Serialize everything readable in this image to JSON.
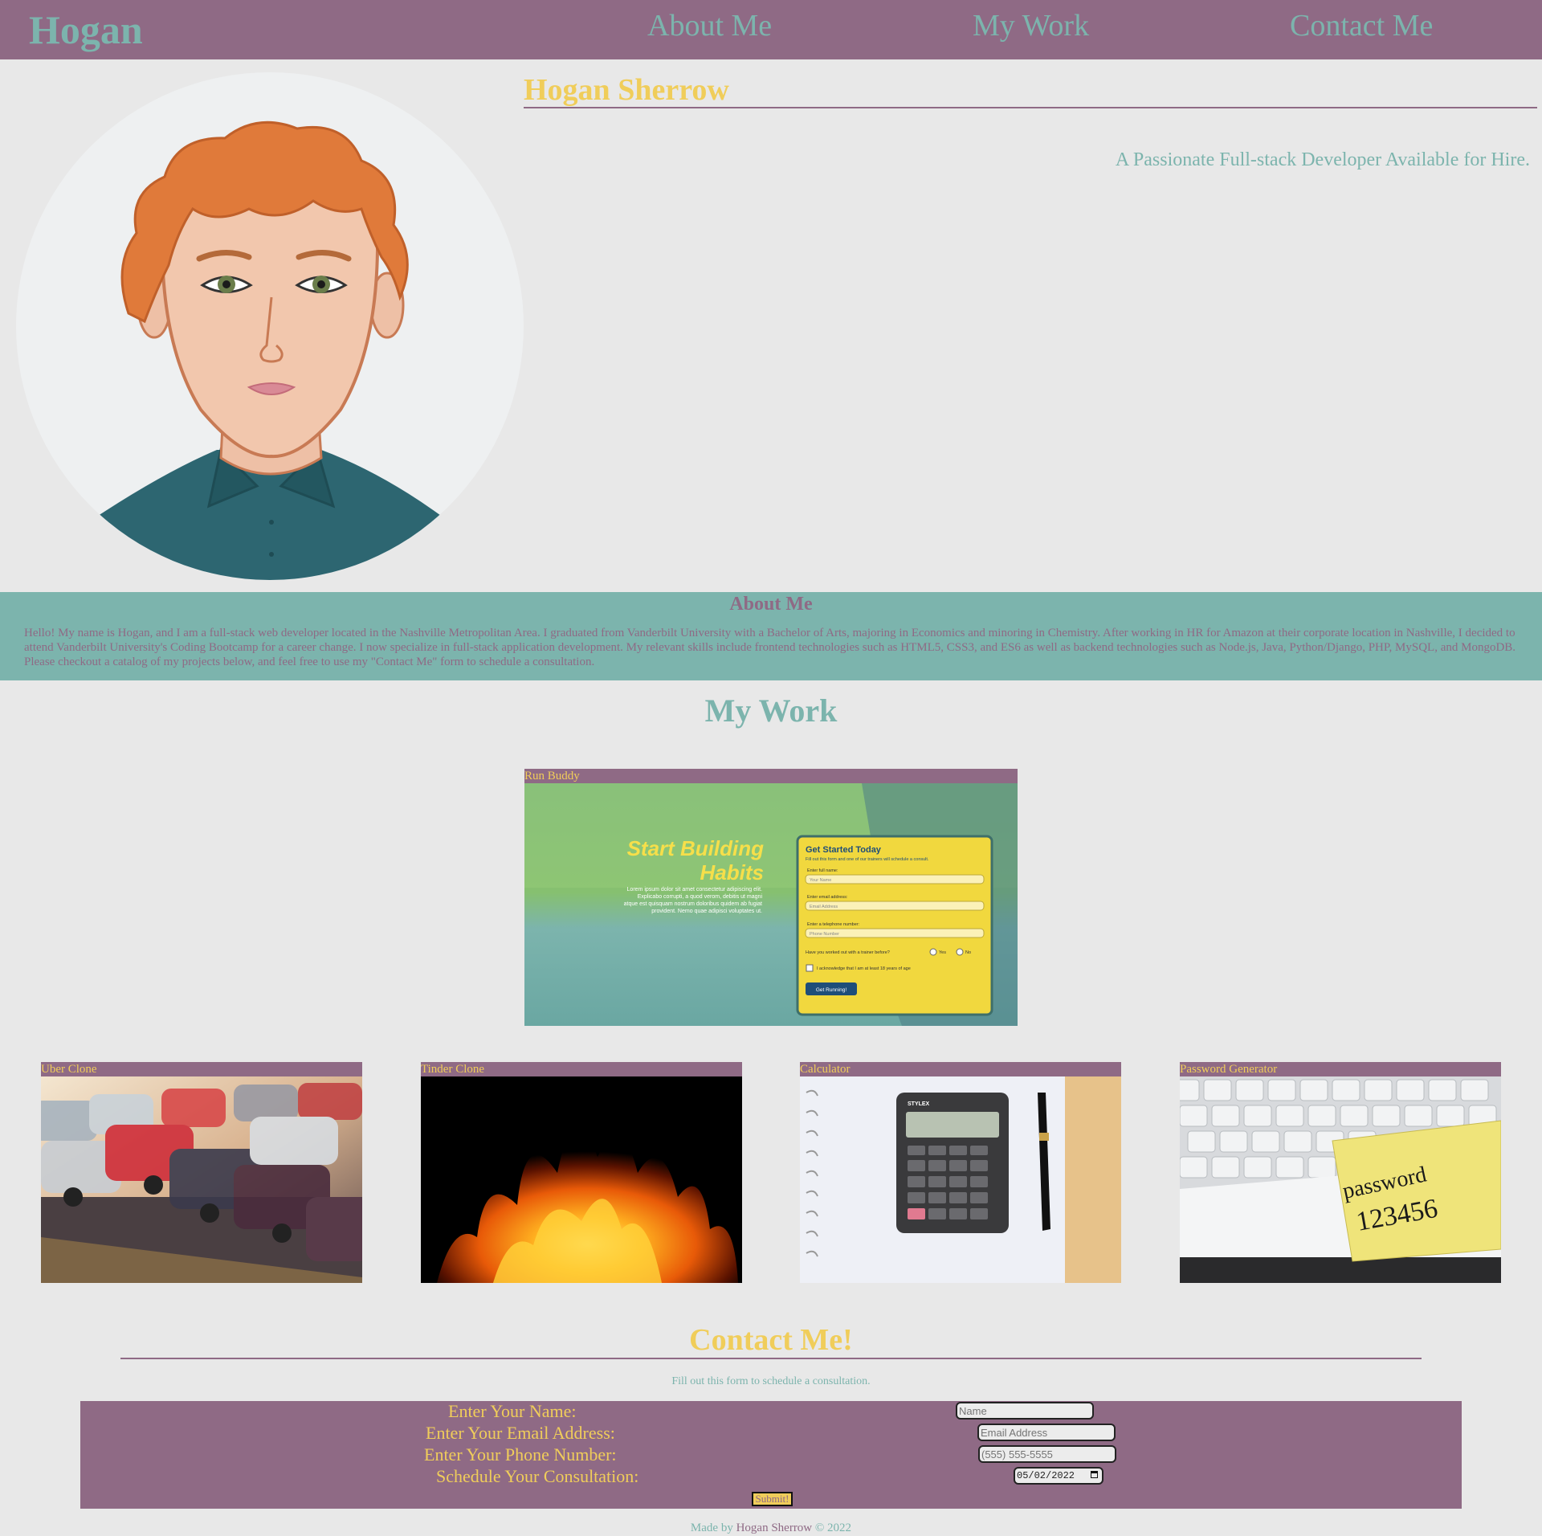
{
  "header": {
    "brand": "Hogan",
    "nav": {
      "about": "About Me",
      "work": "My Work",
      "contact": "Contact Me"
    }
  },
  "hero": {
    "name": "Hogan Sherrow",
    "tagline": "A Passionate Full-stack Developer Available for Hire."
  },
  "about": {
    "title": "About Me",
    "body": "Hello! My name is Hogan, and I am a full-stack web developer located in the Nashville Metropolitan Area. I graduated from Vanderbilt University with a Bachelor of Arts, majoring in Economics and minoring in Chemistry. After working in HR for Amazon at their corporate location in Nashville, I decided to attend Vanderbilt University's Coding Bootcamp for a career change. I now specialize in full-stack application development. My relevant skills include frontend technologies such as HTML5, CSS3, and ES6 as well as backend technologies such as Node.js, Java, Python/Django, PHP, MySQL, and MongoDB. Please checkout a catalog of my projects below, and feel free to use my \"Contact Me\" form to schedule a consultation."
  },
  "work": {
    "title": "My Work",
    "featured": {
      "title": "Run Buddy",
      "screenshot": {
        "heading_line1": "Start Building",
        "heading_line2": "Habits",
        "blurb_lines": [
          "Lorem ipsum dolor sit amet consectetur adipiscing elit.",
          "Explicabo corrupti, a quod verom, debitis ut magni",
          "atque est quisquam nostrum doloribus quidem ab fugiat",
          "provident. Nemo quae adipisci voluptates ut."
        ],
        "form_title": "Get Started Today",
        "form_sub": "Fill out this form and one of our trainers will schedule a consult.",
        "name_label": "Enter full name:",
        "name_placeholder": "Your Name",
        "email_label": "Enter email address:",
        "email_placeholder": "Email Address",
        "phone_label": "Enter a telephone number:",
        "phone_placeholder": "Phone Number",
        "trainer_question": "Have you worked out with a trainer before?",
        "yes": "Yes",
        "no": "No",
        "ack": "I acknowledge that I am at least 18 years of age",
        "cta": "Get Running!"
      }
    },
    "projects": [
      {
        "title": "Uber Clone"
      },
      {
        "title": "Tinder Clone"
      },
      {
        "title": "Calculator",
        "calc_brand": "STYLEX"
      },
      {
        "title": "Password Generator",
        "note_line1": "password",
        "note_line2": "123456"
      }
    ]
  },
  "contact": {
    "title": "Contact Me!",
    "subtitle": "Fill out this form to schedule a consultation.",
    "name_label": "Enter Your Name:",
    "name_placeholder": "Name",
    "email_label": "Enter Your Email Address:",
    "email_placeholder": "Email Address",
    "phone_label": "Enter Your Phone Number:",
    "phone_placeholder": "(555) 555-5555",
    "date_label": "Schedule Your Consultation:",
    "date_value": "05/02/2022",
    "submit": "Submit!"
  },
  "footer": {
    "prefix": "Made by ",
    "author": "Hogan Sherrow",
    "suffix": " © 2022"
  },
  "colors": {
    "purple": "#8f6a85",
    "teal": "#7cb4ad",
    "gold": "#f0cd5a",
    "background": "#e8e8e8"
  }
}
